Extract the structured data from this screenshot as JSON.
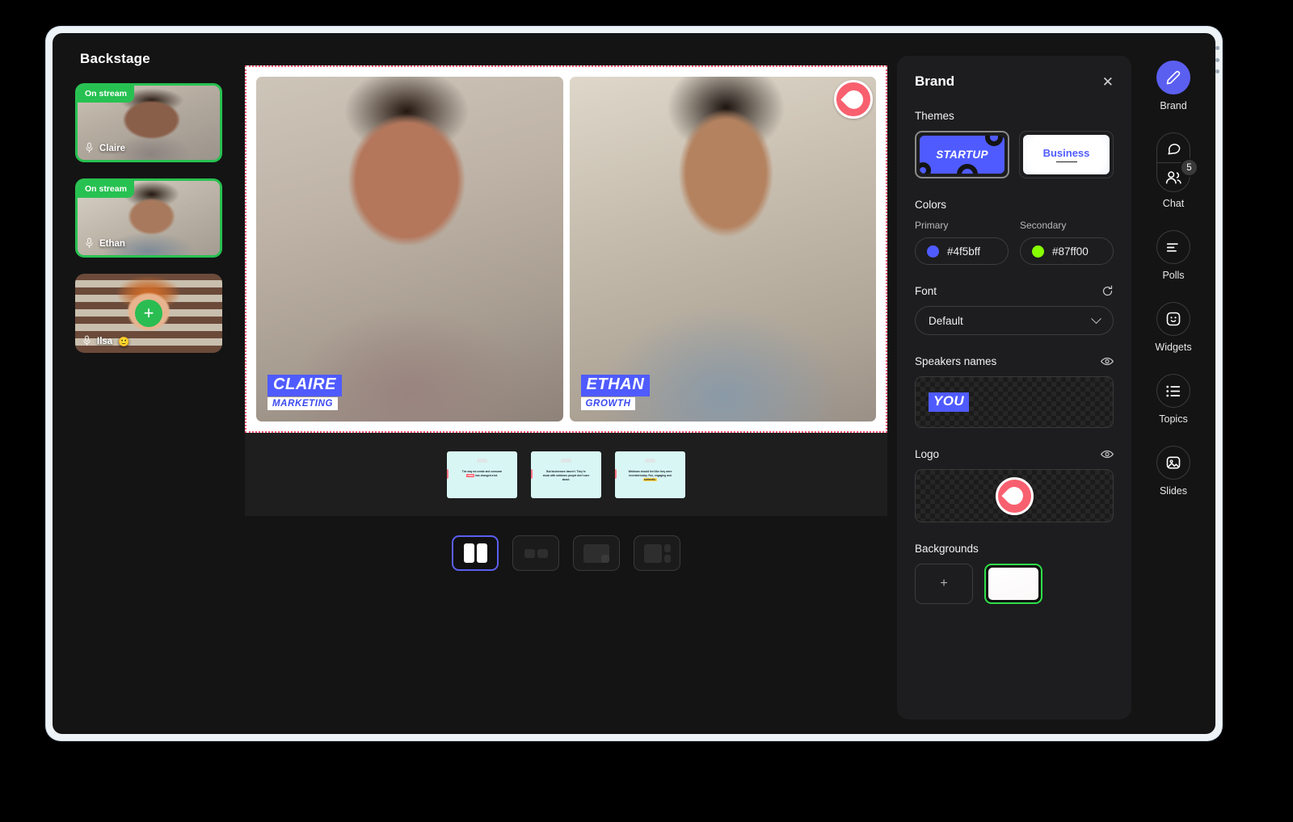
{
  "backstage": {
    "title": "Backstage",
    "cards": [
      {
        "name": "Claire",
        "status": "On stream",
        "live": true,
        "mic_icon": "microphone-icon",
        "emoji": ""
      },
      {
        "name": "Ethan",
        "status": "On stream",
        "live": true,
        "mic_icon": "microphone-icon",
        "emoji": ""
      },
      {
        "name": "Ilsa",
        "status": "",
        "live": false,
        "mic_icon": "microphone-icon",
        "emoji": "🙂",
        "add_label": "+"
      }
    ]
  },
  "stage": {
    "logo_icon": "brand-logo-icon",
    "speakers": [
      {
        "name": "CLAIRE",
        "role": "MARKETING"
      },
      {
        "name": "ETHAN",
        "role": "GROWTH"
      }
    ],
    "slides": [
      {
        "line1": "The way we create and consume",
        "pre2": "",
        "hl2": "video",
        "post2": "has changed a lot.",
        "hl_color": "#ff4d5e"
      },
      {
        "line1": "But businesses haven't. They're",
        "pre2": "stuck with webinars people don't care",
        "hl2": "",
        "post2": "about.",
        "hl_color": "#5668f5"
      },
      {
        "line1": "Webinars should feel like they were",
        "pre2": "invented today. Fun, engaging and",
        "hl2": "authentic.",
        "post2": "",
        "hl_color": "#ffd84d"
      }
    ],
    "layouts": [
      {
        "id": "split-two",
        "label": "Split two",
        "selected": true
      },
      {
        "id": "two-small",
        "label": "Two small",
        "selected": false
      },
      {
        "id": "screen-pip",
        "label": "Screen with picture in picture",
        "selected": false
      },
      {
        "id": "screen-sidebar",
        "label": "Screen with sidebar",
        "selected": false
      }
    ]
  },
  "brand_panel": {
    "title": "Brand",
    "close_icon": "close-icon",
    "themes": {
      "label": "Themes",
      "items": [
        {
          "name": "STARTUP",
          "selected": true
        },
        {
          "name": "Business",
          "selected": false
        }
      ]
    },
    "colors": {
      "label": "Colors",
      "primary": {
        "caption": "Primary",
        "value": "#4f5bff"
      },
      "secondary": {
        "caption": "Secondary",
        "value": "#87ff00"
      }
    },
    "font": {
      "label": "Font",
      "reset_icon": "reset-icon",
      "value": "Default",
      "chevron_icon": "chevron-down-icon"
    },
    "speakers_names": {
      "label": "Speakers names",
      "visibility_icon": "eye-icon",
      "preview_text": "YOU"
    },
    "logo": {
      "label": "Logo",
      "visibility_icon": "eye-icon",
      "preview_icon": "brand-logo-icon"
    },
    "backgrounds": {
      "label": "Backgrounds",
      "add_label": "+",
      "items": [
        {
          "id": "white",
          "selected": true
        }
      ]
    }
  },
  "rail": {
    "items": [
      {
        "label": "Brand",
        "icon": "pencil-icon",
        "active": true,
        "badge": ""
      },
      {
        "label": "Chat",
        "icon": "chat-icon",
        "active": false,
        "badge": "5",
        "second_icon": "people-icon"
      },
      {
        "label": "Polls",
        "icon": "polls-icon",
        "active": false,
        "badge": ""
      },
      {
        "label": "Widgets",
        "icon": "widgets-icon",
        "active": false,
        "badge": ""
      },
      {
        "label": "Topics",
        "icon": "topics-icon",
        "active": false,
        "badge": ""
      },
      {
        "label": "Slides",
        "icon": "slides-icon",
        "active": false,
        "badge": ""
      }
    ]
  }
}
